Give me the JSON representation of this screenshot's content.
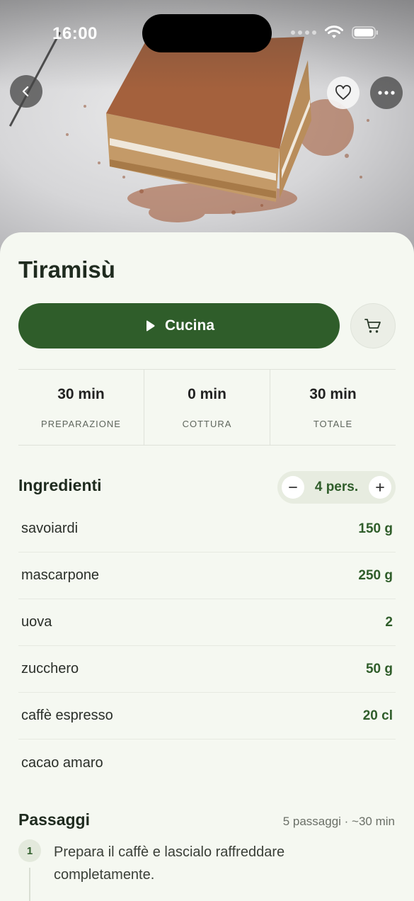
{
  "status_bar": {
    "time": "16:00"
  },
  "recipe": {
    "title": "Tiramisù",
    "cook_label": "Cucina"
  },
  "times": [
    {
      "value": "30 min",
      "label": "PREPARAZIONE"
    },
    {
      "value": "0 min",
      "label": "COTTURA"
    },
    {
      "value": "30 min",
      "label": "TOTALE"
    }
  ],
  "ingredients": {
    "heading": "Ingredienti",
    "servings": "4 pers.",
    "items": [
      {
        "name": "savoiardi",
        "qty": "150 g"
      },
      {
        "name": "mascarpone",
        "qty": "250 g"
      },
      {
        "name": "uova",
        "qty": "2"
      },
      {
        "name": "zucchero",
        "qty": "50 g"
      },
      {
        "name": "caffè espresso",
        "qty": "20 cl"
      },
      {
        "name": "cacao amaro",
        "qty": ""
      }
    ]
  },
  "steps": {
    "heading": "Passaggi",
    "meta": "5 passaggi · ~30 min",
    "items": [
      {
        "num": "1",
        "text": "Prepara il caffè e lascialo raffreddare completamente."
      }
    ]
  },
  "icons": {
    "back": "chevron-left-icon",
    "favorite": "heart-icon",
    "more": "ellipsis-icon",
    "play": "play-icon",
    "cart": "cart-icon",
    "minus": "minus-icon",
    "plus": "plus-icon"
  },
  "colors": {
    "accent": "#2f5d2a",
    "background": "#f5f8f1"
  }
}
